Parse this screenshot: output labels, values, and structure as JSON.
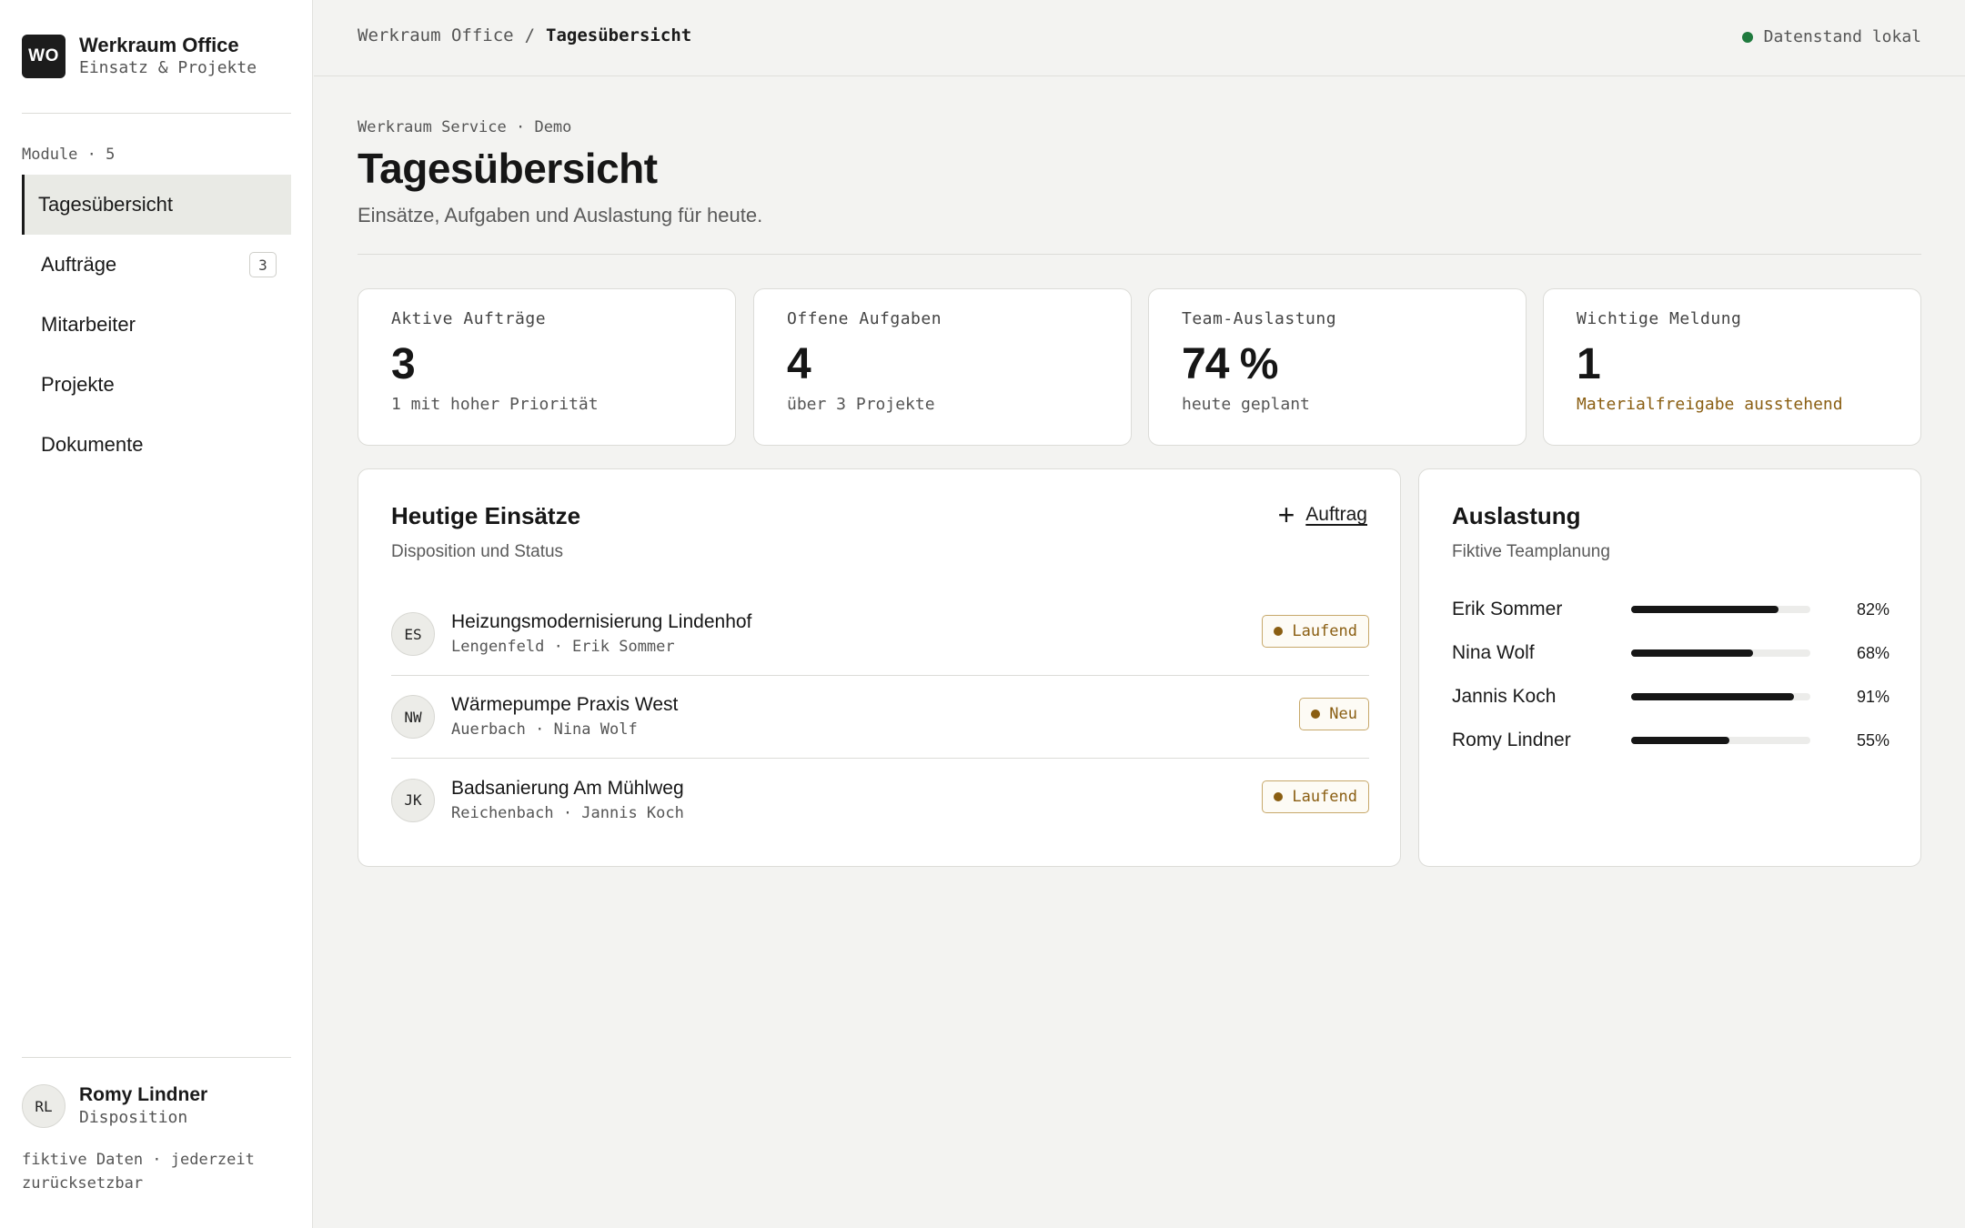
{
  "sidebar": {
    "logo_text": "WO",
    "brand_name": "Werkraum Office",
    "brand_sub": "Einsatz & Projekte",
    "modules_label": "Module · 5",
    "items": [
      {
        "label": "Tagesübersicht",
        "active": true
      },
      {
        "label": "Aufträge",
        "count": "3"
      },
      {
        "label": "Mitarbeiter"
      },
      {
        "label": "Projekte"
      },
      {
        "label": "Dokumente"
      }
    ],
    "user": {
      "initials": "RL",
      "name": "Romy Lindner",
      "role": "Disposition"
    },
    "footnote": "fiktive Daten · jederzeit zurücksetzbar"
  },
  "topbar": {
    "breadcrumb_root": "Werkraum Office",
    "breadcrumb_sep": "/",
    "breadcrumb_current": "Tagesübersicht",
    "status_text": "Datenstand lokal",
    "status_color": "#1f7a3e"
  },
  "header": {
    "eyebrow": "Werkraum Service · Demo",
    "title": "Tagesübersicht",
    "subtitle": "Einsätze, Aufgaben und Auslastung für heute."
  },
  "stats": [
    {
      "label": "Aktive Aufträge",
      "value": "3",
      "note": "1 mit hoher Priorität"
    },
    {
      "label": "Offene Aufgaben",
      "value": "4",
      "note": "über 3 Projekte"
    },
    {
      "label": "Team-Auslastung",
      "value": "74 %",
      "note": "heute geplant"
    },
    {
      "label": "Wichtige Meldung",
      "value": "1",
      "note": "Materialfreigabe ausstehend"
    }
  ],
  "operations": {
    "title": "Heutige Einsätze",
    "subtitle": "Disposition und Status",
    "add_label": "Auftrag",
    "jobs": [
      {
        "initials": "ES",
        "title": "Heizungsmodernisierung Lindenhof",
        "meta": "Lengenfeld · Erik Sommer",
        "status": "Laufend"
      },
      {
        "initials": "NW",
        "title": "Wärmepumpe Praxis West",
        "meta": "Auerbach · Nina Wolf",
        "status": "Neu"
      },
      {
        "initials": "JK",
        "title": "Badsanierung Am Mühlweg",
        "meta": "Reichenbach · Jannis Koch",
        "status": "Laufend"
      }
    ]
  },
  "utilization": {
    "title": "Auslastung",
    "subtitle": "Fiktive Teamplanung",
    "rows": [
      {
        "name": "Erik Sommer",
        "value": 82,
        "label": "82%"
      },
      {
        "name": "Nina Wolf",
        "value": 68,
        "label": "68%"
      },
      {
        "name": "Jannis Koch",
        "value": 91,
        "label": "91%"
      },
      {
        "name": "Romy Lindner",
        "value": 55,
        "label": "55%"
      }
    ]
  },
  "colors": {
    "accent": "#161616",
    "status_warn": "#8a5e12",
    "status_ok": "#1f7a3e"
  }
}
